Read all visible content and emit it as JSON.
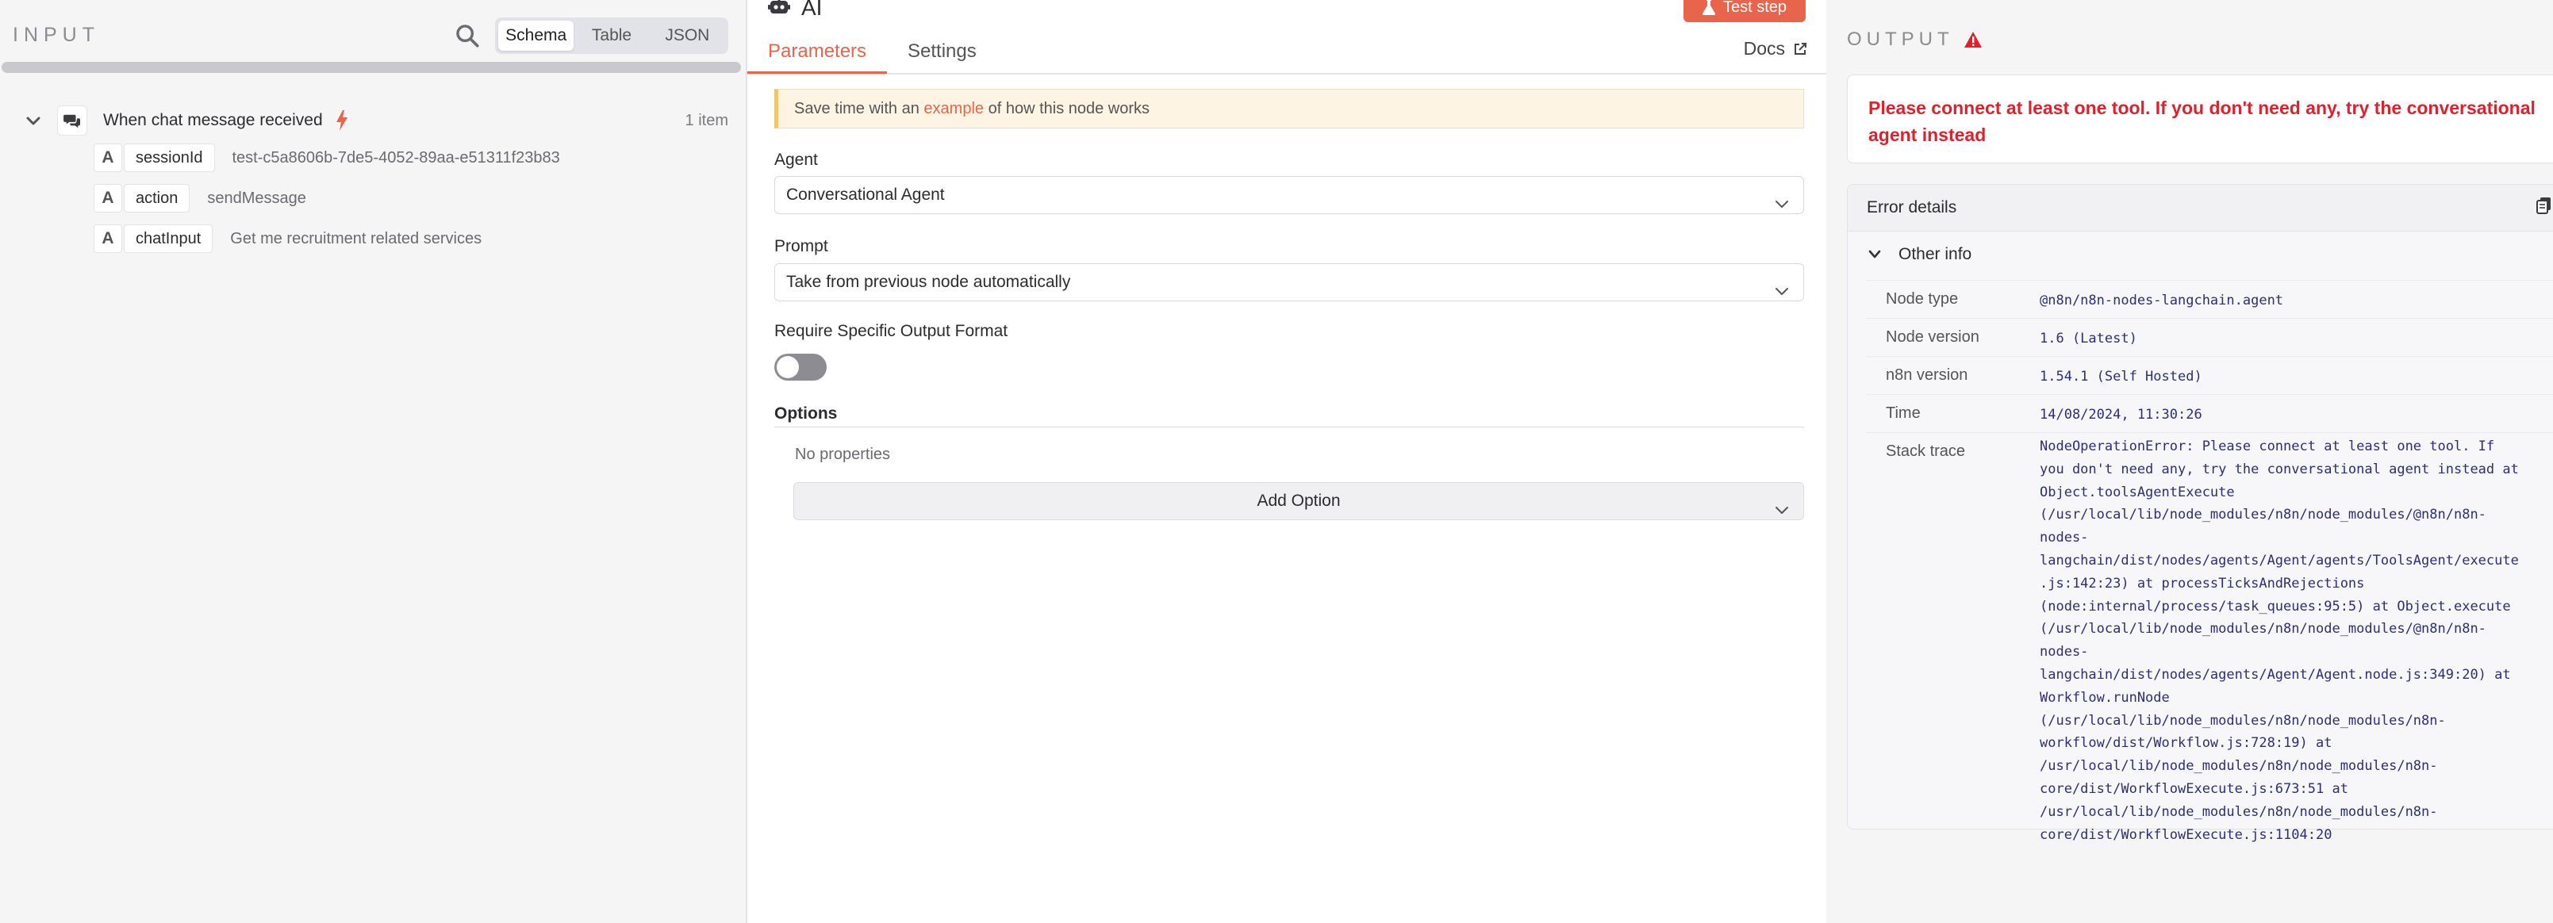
{
  "input": {
    "title": "INPUT",
    "view_options": [
      "Schema",
      "Table",
      "JSON"
    ],
    "active_view": "Schema",
    "root": {
      "label": "When chat message received",
      "count": "1 item"
    },
    "fields": [
      {
        "type": "A",
        "key": "sessionId",
        "value": "test-c5a8606b-7de5-4052-89aa-e51311f23b83"
      },
      {
        "type": "A",
        "key": "action",
        "value": "sendMessage"
      },
      {
        "type": "A",
        "key": "chatInput",
        "value": "Get me recruitment related services"
      }
    ]
  },
  "node": {
    "title": "AI",
    "test_button": "Test step",
    "tabs": [
      "Parameters",
      "Settings"
    ],
    "active_tab": "Parameters",
    "docs_label": "Docs",
    "notice": {
      "prefix": "Save time with an ",
      "link": "example",
      "suffix": " of how this node works"
    },
    "agent_label": "Agent",
    "agent_value": "Conversational Agent",
    "prompt_label": "Prompt",
    "prompt_value": "Take from previous node automatically",
    "output_format_label": "Require Specific Output Format",
    "output_format_enabled": false,
    "options_title": "Options",
    "no_properties": "No properties",
    "add_option": "Add Option"
  },
  "output": {
    "title": "OUTPUT",
    "error_message": "Please connect at least one tool. If you don't need any, try the conversational agent instead",
    "details_title": "Error details",
    "other_info_label": "Other info",
    "rows": [
      {
        "key": "Node type",
        "value": "@n8n/n8n-nodes-langchain.agent"
      },
      {
        "key": "Node version",
        "value": "1.6 (Latest)"
      },
      {
        "key": "n8n version",
        "value": "1.54.1 (Self Hosted)"
      },
      {
        "key": "Time",
        "value": "14/08/2024, 11:30:26"
      }
    ],
    "stack_label": "Stack trace",
    "stack_trace": "NodeOperationError: Please connect at least one tool. If you don't need any, try the conversational agent instead at Object.toolsAgentExecute (/usr/local/lib/node_modules/n8n/node_modules/@n8n/n8n-nodes-langchain/dist/nodes/agents/Agent/agents/ToolsAgent/execute.js:142:23) at processTicksAndRejections (node:internal/process/task_queues:95:5) at Object.execute (/usr/local/lib/node_modules/n8n/node_modules/@n8n/n8n-nodes-langchain/dist/nodes/agents/Agent/Agent.node.js:349:20) at Workflow.runNode (/usr/local/lib/node_modules/n8n/node_modules/n8n-workflow/dist/Workflow.js:728:19) at /usr/local/lib/node_modules/n8n/node_modules/n8n-core/dist/WorkflowExecute.js:673:51 at /usr/local/lib/node_modules/n8n/node_modules/n8n-core/dist/WorkflowExecute.js:1104:20"
  },
  "colors": {
    "accent": "#e8644a",
    "error": "#e0202c",
    "mono_text": "#2e2e78"
  },
  "icons": [
    "search-icon",
    "chevron-down-icon",
    "chat-icon",
    "bolt-icon",
    "robot-icon",
    "flask-icon",
    "external-link-icon",
    "warning-icon",
    "copy-icon"
  ]
}
